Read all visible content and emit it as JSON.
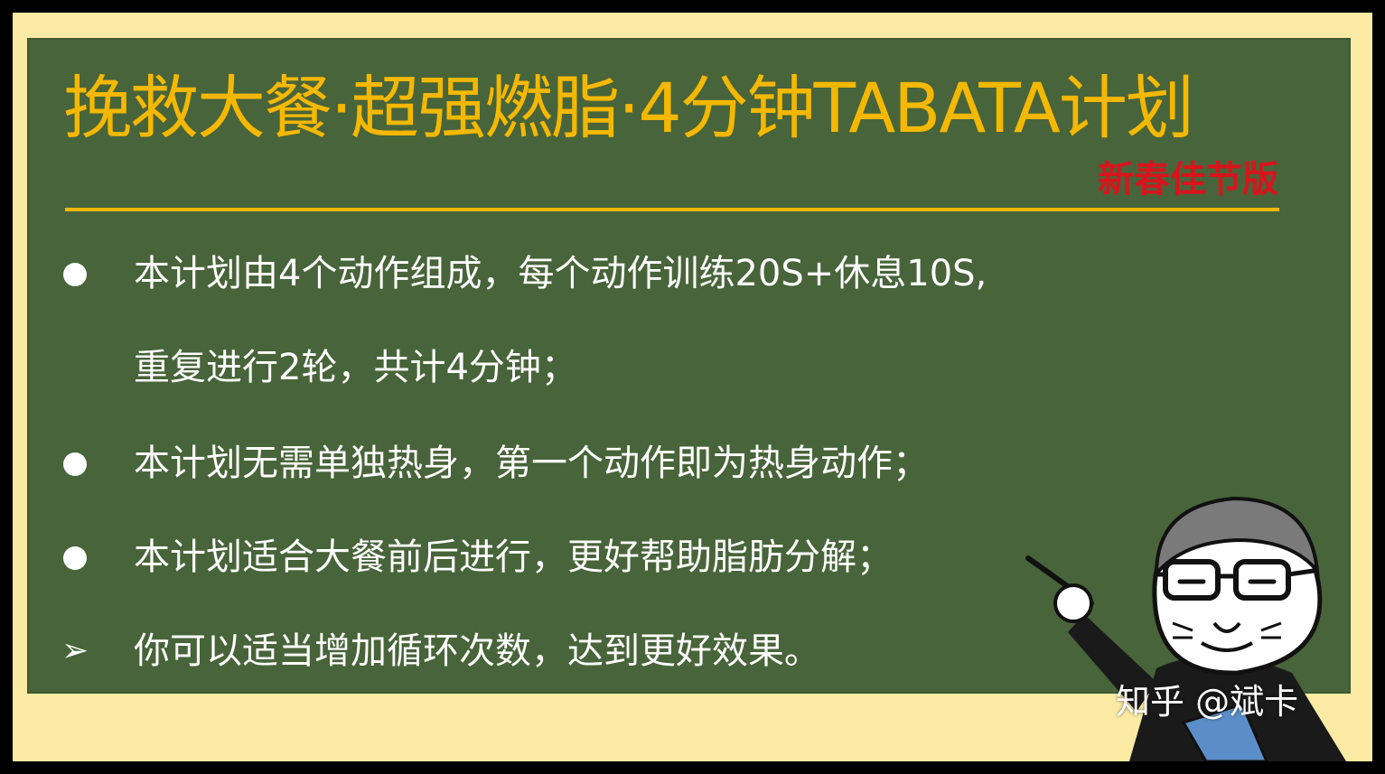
{
  "title": "挽救大餐·超强燃脂·4分钟TABATA计划",
  "subtitle": "新春佳节版",
  "bullets": [
    {
      "marker": "dot",
      "text": "本计划由4个动作组成，每个动作训练20S+休息10S,"
    },
    {
      "marker": "none",
      "text": "重复进行2轮，共计4分钟；"
    },
    {
      "marker": "dot",
      "text": "本计划无需单独热身，第一个动作即为热身动作；"
    },
    {
      "marker": "dot",
      "text": "本计划适合大餐前后进行，更好帮助脂肪分解；"
    },
    {
      "marker": "arrow",
      "glyph": "➢",
      "text": "你可以适当增加循环次数，达到更好效果。"
    }
  ],
  "watermark": "知乎 @斌卡",
  "colors": {
    "border": "#000000",
    "frame": "#fbeaa3",
    "board": "#48643a",
    "title": "#f5b800",
    "subtitle": "#d9141d",
    "text": "#ffffff"
  }
}
